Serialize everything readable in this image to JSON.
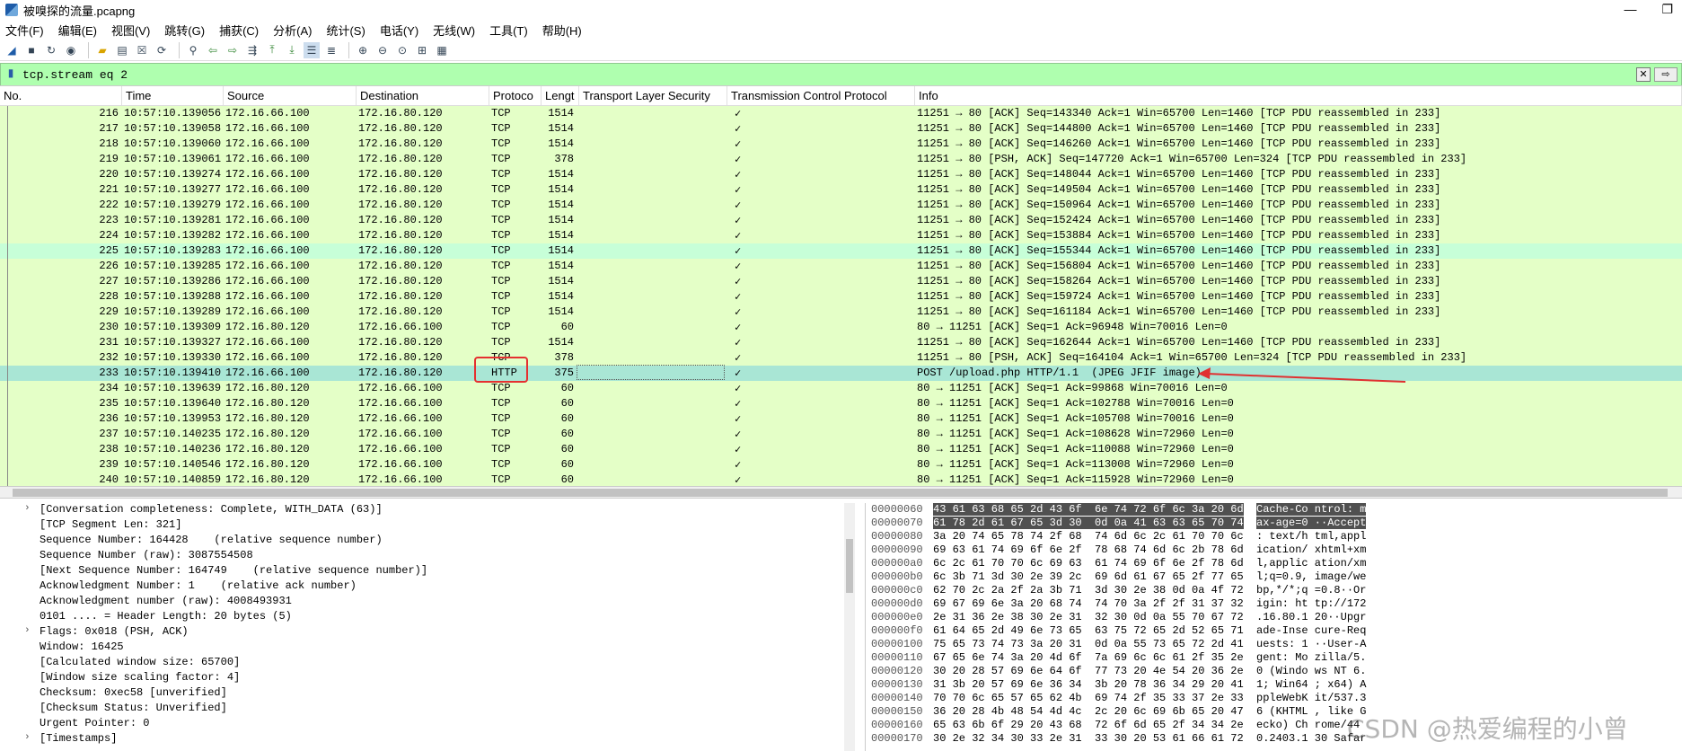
{
  "window": {
    "title": "被嗅探的流量.pcapng"
  },
  "menu": [
    "文件(F)",
    "编辑(E)",
    "视图(V)",
    "跳转(G)",
    "捕获(C)",
    "分析(A)",
    "统计(S)",
    "电话(Y)",
    "无线(W)",
    "工具(T)",
    "帮助(H)"
  ],
  "filter": {
    "value": "tcp.stream eq 2"
  },
  "columns": [
    "No.",
    "Time",
    "Source",
    "Destination",
    "Protoco",
    "Lengt",
    "Transport Layer Security",
    "Transmission Control Protocol",
    "Info"
  ],
  "packets": [
    {
      "no": "216",
      "time": "10:57:10.139056",
      "src": "172.16.66.100",
      "dst": "172.16.80.120",
      "proto": "TCP",
      "len": "1514",
      "tls": "",
      "tcp": "✓",
      "info": "11251 → 80 [ACK] Seq=143340 Ack=1 Win=65700 Len=1460 [TCP PDU reassembled in 233]"
    },
    {
      "no": "217",
      "time": "10:57:10.139058",
      "src": "172.16.66.100",
      "dst": "172.16.80.120",
      "proto": "TCP",
      "len": "1514",
      "tls": "",
      "tcp": "✓",
      "info": "11251 → 80 [ACK] Seq=144800 Ack=1 Win=65700 Len=1460 [TCP PDU reassembled in 233]"
    },
    {
      "no": "218",
      "time": "10:57:10.139060",
      "src": "172.16.66.100",
      "dst": "172.16.80.120",
      "proto": "TCP",
      "len": "1514",
      "tls": "",
      "tcp": "✓",
      "info": "11251 → 80 [ACK] Seq=146260 Ack=1 Win=65700 Len=1460 [TCP PDU reassembled in 233]"
    },
    {
      "no": "219",
      "time": "10:57:10.139061",
      "src": "172.16.66.100",
      "dst": "172.16.80.120",
      "proto": "TCP",
      "len": "378",
      "tls": "",
      "tcp": "✓",
      "info": "11251 → 80 [PSH, ACK] Seq=147720 Ack=1 Win=65700 Len=324 [TCP PDU reassembled in 233]"
    },
    {
      "no": "220",
      "time": "10:57:10.139274",
      "src": "172.16.66.100",
      "dst": "172.16.80.120",
      "proto": "TCP",
      "len": "1514",
      "tls": "",
      "tcp": "✓",
      "info": "11251 → 80 [ACK] Seq=148044 Ack=1 Win=65700 Len=1460 [TCP PDU reassembled in 233]"
    },
    {
      "no": "221",
      "time": "10:57:10.139277",
      "src": "172.16.66.100",
      "dst": "172.16.80.120",
      "proto": "TCP",
      "len": "1514",
      "tls": "",
      "tcp": "✓",
      "info": "11251 → 80 [ACK] Seq=149504 Ack=1 Win=65700 Len=1460 [TCP PDU reassembled in 233]"
    },
    {
      "no": "222",
      "time": "10:57:10.139279",
      "src": "172.16.66.100",
      "dst": "172.16.80.120",
      "proto": "TCP",
      "len": "1514",
      "tls": "",
      "tcp": "✓",
      "info": "11251 → 80 [ACK] Seq=150964 Ack=1 Win=65700 Len=1460 [TCP PDU reassembled in 233]"
    },
    {
      "no": "223",
      "time": "10:57:10.139281",
      "src": "172.16.66.100",
      "dst": "172.16.80.120",
      "proto": "TCP",
      "len": "1514",
      "tls": "",
      "tcp": "✓",
      "info": "11251 → 80 [ACK] Seq=152424 Ack=1 Win=65700 Len=1460 [TCP PDU reassembled in 233]"
    },
    {
      "no": "224",
      "time": "10:57:10.139282",
      "src": "172.16.66.100",
      "dst": "172.16.80.120",
      "proto": "TCP",
      "len": "1514",
      "tls": "",
      "tcp": "✓",
      "info": "11251 → 80 [ACK] Seq=153884 Ack=1 Win=65700 Len=1460 [TCP PDU reassembled in 233]"
    },
    {
      "no": "225",
      "time": "10:57:10.139283",
      "src": "172.16.66.100",
      "dst": "172.16.80.120",
      "proto": "TCP",
      "len": "1514",
      "tls": "",
      "tcp": "✓",
      "info": "11251 → 80 [ACK] Seq=155344 Ack=1 Win=65700 Len=1460 [TCP PDU reassembled in 233]"
    },
    {
      "no": "226",
      "time": "10:57:10.139285",
      "src": "172.16.66.100",
      "dst": "172.16.80.120",
      "proto": "TCP",
      "len": "1514",
      "tls": "",
      "tcp": "✓",
      "info": "11251 → 80 [ACK] Seq=156804 Ack=1 Win=65700 Len=1460 [TCP PDU reassembled in 233]"
    },
    {
      "no": "227",
      "time": "10:57:10.139286",
      "src": "172.16.66.100",
      "dst": "172.16.80.120",
      "proto": "TCP",
      "len": "1514",
      "tls": "",
      "tcp": "✓",
      "info": "11251 → 80 [ACK] Seq=158264 Ack=1 Win=65700 Len=1460 [TCP PDU reassembled in 233]"
    },
    {
      "no": "228",
      "time": "10:57:10.139288",
      "src": "172.16.66.100",
      "dst": "172.16.80.120",
      "proto": "TCP",
      "len": "1514",
      "tls": "",
      "tcp": "✓",
      "info": "11251 → 80 [ACK] Seq=159724 Ack=1 Win=65700 Len=1460 [TCP PDU reassembled in 233]"
    },
    {
      "no": "229",
      "time": "10:57:10.139289",
      "src": "172.16.66.100",
      "dst": "172.16.80.120",
      "proto": "TCP",
      "len": "1514",
      "tls": "",
      "tcp": "✓",
      "info": "11251 → 80 [ACK] Seq=161184 Ack=1 Win=65700 Len=1460 [TCP PDU reassembled in 233]"
    },
    {
      "no": "230",
      "time": "10:57:10.139309",
      "src": "172.16.80.120",
      "dst": "172.16.66.100",
      "proto": "TCP",
      "len": "60",
      "tls": "",
      "tcp": "✓",
      "info": "80 → 11251 [ACK] Seq=1 Ack=96948 Win=70016 Len=0"
    },
    {
      "no": "231",
      "time": "10:57:10.139327",
      "src": "172.16.66.100",
      "dst": "172.16.80.120",
      "proto": "TCP",
      "len": "1514",
      "tls": "",
      "tcp": "✓",
      "info": "11251 → 80 [ACK] Seq=162644 Ack=1 Win=65700 Len=1460 [TCP PDU reassembled in 233]"
    },
    {
      "no": "232",
      "time": "10:57:10.139330",
      "src": "172.16.66.100",
      "dst": "172.16.80.120",
      "proto": "TCP",
      "len": "378",
      "tls": "",
      "tcp": "✓",
      "info": "11251 → 80 [PSH, ACK] Seq=164104 Ack=1 Win=65700 Len=324 [TCP PDU reassembled in 233]"
    },
    {
      "no": "233",
      "time": "10:57:10.139410",
      "src": "172.16.66.100",
      "dst": "172.16.80.120",
      "proto": "HTTP",
      "len": "375",
      "tls": "",
      "tcp": "✓",
      "info": "POST /upload.php HTTP/1.1  (JPEG JFIF image)"
    },
    {
      "no": "234",
      "time": "10:57:10.139639",
      "src": "172.16.80.120",
      "dst": "172.16.66.100",
      "proto": "TCP",
      "len": "60",
      "tls": "",
      "tcp": "✓",
      "info": "80 → 11251 [ACK] Seq=1 Ack=99868 Win=70016 Len=0"
    },
    {
      "no": "235",
      "time": "10:57:10.139640",
      "src": "172.16.80.120",
      "dst": "172.16.66.100",
      "proto": "TCP",
      "len": "60",
      "tls": "",
      "tcp": "✓",
      "info": "80 → 11251 [ACK] Seq=1 Ack=102788 Win=70016 Len=0"
    },
    {
      "no": "236",
      "time": "10:57:10.139953",
      "src": "172.16.80.120",
      "dst": "172.16.66.100",
      "proto": "TCP",
      "len": "60",
      "tls": "",
      "tcp": "✓",
      "info": "80 → 11251 [ACK] Seq=1 Ack=105708 Win=70016 Len=0"
    },
    {
      "no": "237",
      "time": "10:57:10.140235",
      "src": "172.16.80.120",
      "dst": "172.16.66.100",
      "proto": "TCP",
      "len": "60",
      "tls": "",
      "tcp": "✓",
      "info": "80 → 11251 [ACK] Seq=1 Ack=108628 Win=72960 Len=0"
    },
    {
      "no": "238",
      "time": "10:57:10.140236",
      "src": "172.16.80.120",
      "dst": "172.16.66.100",
      "proto": "TCP",
      "len": "60",
      "tls": "",
      "tcp": "✓",
      "info": "80 → 11251 [ACK] Seq=1 Ack=110088 Win=72960 Len=0"
    },
    {
      "no": "239",
      "time": "10:57:10.140546",
      "src": "172.16.80.120",
      "dst": "172.16.66.100",
      "proto": "TCP",
      "len": "60",
      "tls": "",
      "tcp": "✓",
      "info": "80 → 11251 [ACK] Seq=1 Ack=113008 Win=72960 Len=0"
    },
    {
      "no": "240",
      "time": "10:57:10.140859",
      "src": "172.16.80.120",
      "dst": "172.16.66.100",
      "proto": "TCP",
      "len": "60",
      "tls": "",
      "tcp": "✓",
      "info": "80 → 11251 [ACK] Seq=1 Ack=115928 Win=72960 Len=0"
    }
  ],
  "details": [
    {
      "exp": "›",
      "text": "[Conversation completeness: Complete, WITH_DATA (63)]"
    },
    {
      "exp": "",
      "text": "[TCP Segment Len: 321]"
    },
    {
      "exp": "",
      "text": "Sequence Number: 164428    (relative sequence number)"
    },
    {
      "exp": "",
      "text": "Sequence Number (raw): 3087554508"
    },
    {
      "exp": "",
      "text": "[Next Sequence Number: 164749    (relative sequence number)]"
    },
    {
      "exp": "",
      "text": "Acknowledgment Number: 1    (relative ack number)"
    },
    {
      "exp": "",
      "text": "Acknowledgment number (raw): 4008493931"
    },
    {
      "exp": "",
      "text": "0101 .... = Header Length: 20 bytes (5)"
    },
    {
      "exp": "›",
      "text": "Flags: 0x018 (PSH, ACK)"
    },
    {
      "exp": "",
      "text": "Window: 16425"
    },
    {
      "exp": "",
      "text": "[Calculated window size: 65700]"
    },
    {
      "exp": "",
      "text": "[Window size scaling factor: 4]"
    },
    {
      "exp": "",
      "text": "Checksum: 0xec58 [unverified]"
    },
    {
      "exp": "",
      "text": "[Checksum Status: Unverified]"
    },
    {
      "exp": "",
      "text": "Urgent Pointer: 0"
    },
    {
      "exp": "›",
      "text": "[Timestamps]"
    }
  ],
  "hex": [
    {
      "off": "00000060",
      "bytes": "43 61 63 68 65 2d 43 6f  6e 74 72 6f 6c 3a 20 6d",
      "ascii": "Cache-Co ntrol: m",
      "hi": true
    },
    {
      "off": "00000070",
      "bytes": "61 78 2d 61 67 65 3d 30  0d 0a 41 63 63 65 70 74",
      "ascii": "ax-age=0 ··Accept",
      "hi": true
    },
    {
      "off": "00000080",
      "bytes": "3a 20 74 65 78 74 2f 68  74 6d 6c 2c 61 70 70 6c",
      "ascii": ": text/h tml,appl",
      "hi": false
    },
    {
      "off": "00000090",
      "bytes": "69 63 61 74 69 6f 6e 2f  78 68 74 6d 6c 2b 78 6d",
      "ascii": "ication/ xhtml+xm",
      "hi": false
    },
    {
      "off": "000000a0",
      "bytes": "6c 2c 61 70 70 6c 69 63  61 74 69 6f 6e 2f 78 6d",
      "ascii": "l,applic ation/xm",
      "hi": false
    },
    {
      "off": "000000b0",
      "bytes": "6c 3b 71 3d 30 2e 39 2c  69 6d 61 67 65 2f 77 65",
      "ascii": "l;q=0.9, image/we",
      "hi": false
    },
    {
      "off": "000000c0",
      "bytes": "62 70 2c 2a 2f 2a 3b 71  3d 30 2e 38 0d 0a 4f 72",
      "ascii": "bp,*/*;q =0.8··Or",
      "hi": false
    },
    {
      "off": "000000d0",
      "bytes": "69 67 69 6e 3a 20 68 74  74 70 3a 2f 2f 31 37 32",
      "ascii": "igin: ht tp://172",
      "hi": false
    },
    {
      "off": "000000e0",
      "bytes": "2e 31 36 2e 38 30 2e 31  32 30 0d 0a 55 70 67 72",
      "ascii": ".16.80.1 20··Upgr",
      "hi": false
    },
    {
      "off": "000000f0",
      "bytes": "61 64 65 2d 49 6e 73 65  63 75 72 65 2d 52 65 71",
      "ascii": "ade-Inse cure-Req",
      "hi": false
    },
    {
      "off": "00000100",
      "bytes": "75 65 73 74 73 3a 20 31  0d 0a 55 73 65 72 2d 41",
      "ascii": "uests: 1 ··User-A",
      "hi": false
    },
    {
      "off": "00000110",
      "bytes": "67 65 6e 74 3a 20 4d 6f  7a 69 6c 6c 61 2f 35 2e",
      "ascii": "gent: Mo zilla/5.",
      "hi": false
    },
    {
      "off": "00000120",
      "bytes": "30 20 28 57 69 6e 64 6f  77 73 20 4e 54 20 36 2e",
      "ascii": "0 (Windo ws NT 6.",
      "hi": false
    },
    {
      "off": "00000130",
      "bytes": "31 3b 20 57 69 6e 36 34  3b 20 78 36 34 29 20 41",
      "ascii": "1; Win64 ; x64) A",
      "hi": false
    },
    {
      "off": "00000140",
      "bytes": "70 70 6c 65 57 65 62 4b  69 74 2f 35 33 37 2e 33",
      "ascii": "ppleWebK it/537.3",
      "hi": false
    },
    {
      "off": "00000150",
      "bytes": "36 20 28 4b 48 54 4d 4c  2c 20 6c 69 6b 65 20 47",
      "ascii": "6 (KHTML , like G",
      "hi": false
    },
    {
      "off": "00000160",
      "bytes": "65 63 6b 6f 29 20 43 68  72 6f 6d 65 2f 34 34 2e",
      "ascii": "ecko) Ch rome/44",
      "hi": false
    },
    {
      "off": "00000170",
      "bytes": "30 2e 32 34 30 33 2e 31  33 30 20 53 61 66 61 72",
      "ascii": "0.2403.1 30 Safar",
      "hi": false
    }
  ],
  "watermark": "CSDN @热爱编程的小曾"
}
